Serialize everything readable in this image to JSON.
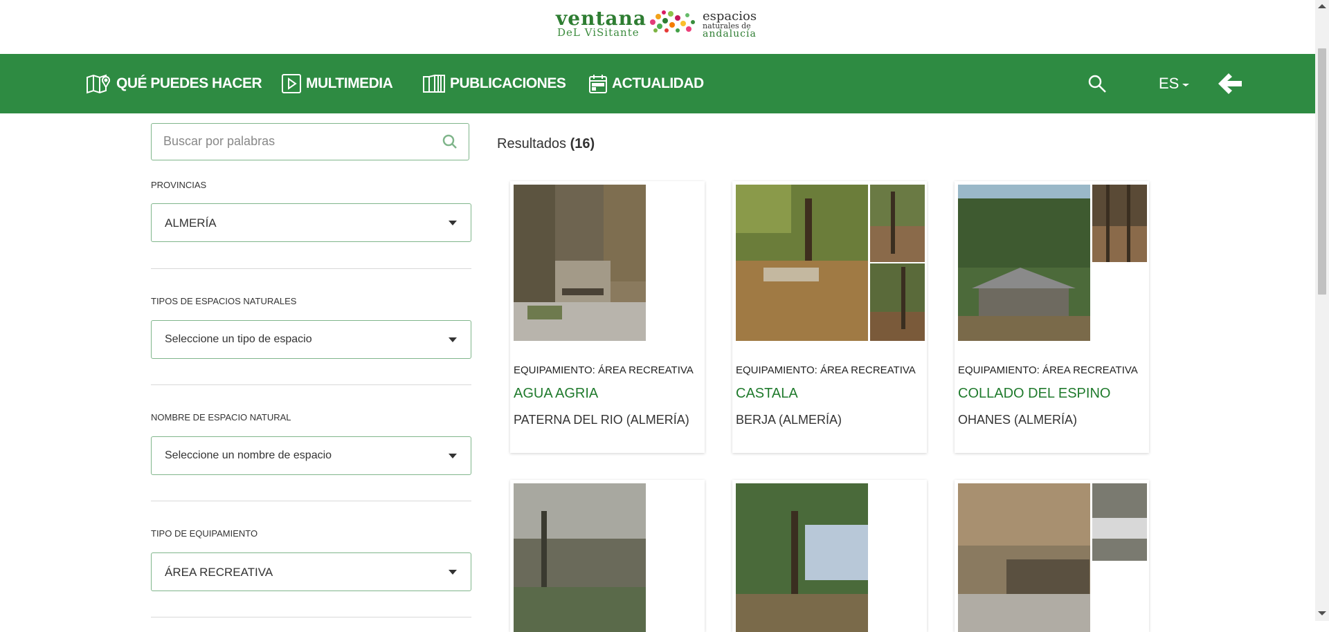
{
  "logo": {
    "line1": "ventana",
    "line2": "DeL ViSitante",
    "line3": "espacios",
    "line4": "naturales de",
    "line5": "andalucía"
  },
  "nav": {
    "items": [
      {
        "label": "QUÉ PUEDES HACER",
        "icon": "map-pin-icon"
      },
      {
        "label": "MULTIMEDIA",
        "icon": "play-icon"
      },
      {
        "label": "PUBLICACIONES",
        "icon": "book-icon"
      },
      {
        "label": "ACTUALIDAD",
        "icon": "calendar-icon"
      }
    ],
    "language": "ES",
    "search_icon": "search-icon",
    "back_icon": "arrow-left-icon"
  },
  "filters": {
    "search_placeholder": "Buscar por palabras",
    "provinces": {
      "label": "PROVINCIAS",
      "value": "ALMERÍA"
    },
    "space_types": {
      "label": "TIPOS DE ESPACIOS NATURALES",
      "value": "Seleccione un tipo de espacio"
    },
    "space_name": {
      "label": "NOMBRE DE ESPACIO NATURAL",
      "value": "Seleccione un nombre de espacio"
    },
    "equipment_type": {
      "label": "TIPO DE EQUIPAMIENTO",
      "value": "ÁREA RECREATIVA"
    }
  },
  "results": {
    "label": "Resultados",
    "count": "(16)",
    "cards": [
      {
        "category": "EQUIPAMIENTO: ÁREA RECREATIVA",
        "title": "AGUA AGRIA",
        "place": "PATERNA DEL RIO (ALMERÍA)"
      },
      {
        "category": "EQUIPAMIENTO: ÁREA RECREATIVA",
        "title": "CASTALA",
        "place": "BERJA (ALMERÍA)"
      },
      {
        "category": "EQUIPAMIENTO: ÁREA RECREATIVA",
        "title": "COLLADO DEL ESPINO",
        "place": "OHANES (ALMERÍA)"
      }
    ]
  },
  "colors": {
    "brand_green": "#2e8b42",
    "title_green": "#1f7a2c",
    "border_green": "#7fb58a"
  }
}
